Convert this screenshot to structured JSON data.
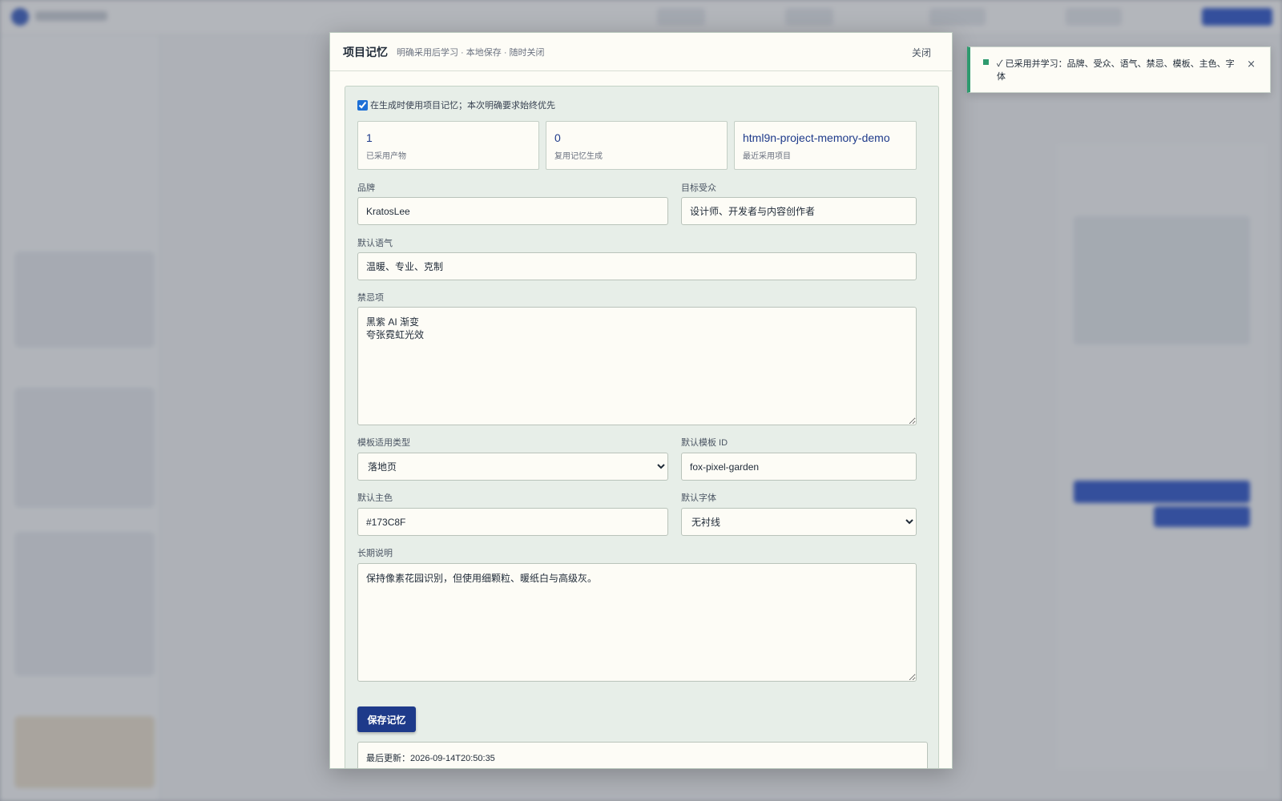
{
  "modal": {
    "title": "项目记忆",
    "subtitle": "明确采用后学习 · 本地保存 · 随时关闭",
    "close_label": "关闭"
  },
  "use_memory": {
    "checked": true,
    "label": "在生成时使用项目记忆；本次明确要求始终优先"
  },
  "stats": [
    {
      "value": "1",
      "label": "已采用产物"
    },
    {
      "value": "0",
      "label": "复用记忆生成"
    },
    {
      "value": "html9n-project-memory-demo",
      "label": "最近采用项目"
    }
  ],
  "form": {
    "brand": {
      "label": "品牌",
      "value": "KratosLee"
    },
    "audience": {
      "label": "目标受众",
      "value": "设计师、开发者与内容创作者"
    },
    "tone": {
      "label": "默认语气",
      "value": "温暖、专业、克制"
    },
    "taboos": {
      "label": "禁忌项",
      "value": "黑紫 AI 渐变\n夸张霓虹光效"
    },
    "template_type": {
      "label": "模板适用类型",
      "value": "落地页"
    },
    "template_id": {
      "label": "默认模板 ID",
      "value": "fox-pixel-garden"
    },
    "primary_color": {
      "label": "默认主色",
      "value": "#173C8F"
    },
    "font": {
      "label": "默认字体",
      "value": "无衬线"
    },
    "notes": {
      "label": "长期说明",
      "value": "保持像素花园识别，但使用细颗粒、暖纸白与高级灰。"
    }
  },
  "save_label": "保存记忆",
  "last_updated": "最后更新：2026-09-14T20:50:35",
  "toast": {
    "text": "✓ 已采用并学习：品牌、受众、语气、禁忌、模板、主色、字体",
    "close_icon": "×"
  },
  "colors": {
    "primary": "#1e3a8a",
    "success": "#2e9a6e",
    "panel": "#e7eee8",
    "paper": "#fdfcf6"
  }
}
